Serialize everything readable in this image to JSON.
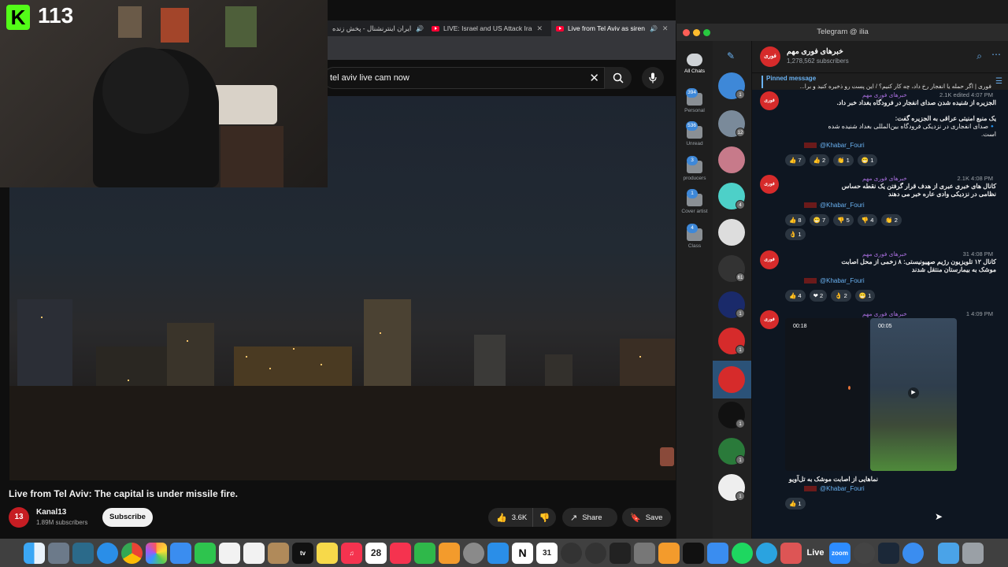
{
  "webcam": {
    "logo_letter": "K",
    "viewer_count": "113"
  },
  "browser": {
    "tabs": [
      {
        "label": "ایران اینترنشنال - پخش زنده",
        "active": false
      },
      {
        "label": "LIVE: Israel and US Attack Ira",
        "active": false
      },
      {
        "label": "Live from Tel Aviv as siren",
        "active": true
      }
    ],
    "search": {
      "query": "tel aviv live cam now"
    }
  },
  "youtube": {
    "video_title": "Live from Tel Aviv: The capital is under missile fire.",
    "channel_avatar_text": "13",
    "channel_name": "Kanal13",
    "channel_subscribers": "1.89M subscribers",
    "subscribe_label": "Subscribe",
    "like_count": "3.6K",
    "share_label": "Share",
    "save_label": "Save"
  },
  "telegram": {
    "window_title": "Telegram @ ilia",
    "folders": [
      {
        "label": "All Chats",
        "badge": ""
      },
      {
        "label": "Personal",
        "badge": "394"
      },
      {
        "label": "Unread",
        "badge": "536"
      },
      {
        "label": "producers",
        "badge": "3"
      },
      {
        "label": "Cover artist",
        "badge": "1"
      },
      {
        "label": "Class",
        "badge": "4"
      }
    ],
    "chat_badges": [
      "1",
      "12",
      "",
      "4",
      "",
      "61",
      "1",
      "1",
      "",
      "1",
      "1",
      "1"
    ],
    "channel": {
      "name": "خبرهای فوری مهم",
      "subscribers": "1,278,562 subscribers",
      "avatar_text": "فوری"
    },
    "pinned": {
      "label": "Pinned message",
      "text": "فوری | اگر حمله یا انفجار رخ داد، چه کار کنیم؟ / این پست رو ذخیره کنید و برا..."
    },
    "messages": [
      {
        "author": "خبرهای فوری مهم",
        "meta": "2.1K edited 4:07 PM",
        "lines": [
          "الجزیره از شنیده شدن صدای انفجار در فرودگاه بغداد خبر داد.",
          "",
          "یک منبع امنیتی عراقی به الجزیره گفت:",
          "🔹صدای انفجاری در نزدیکی فرودگاه بین‌المللی بغداد شنیده شده",
          "است."
        ],
        "link": "@Khabar_Fouri",
        "reactions": [
          "👍 7",
          "👍 2",
          "👏 1",
          "😁 1"
        ]
      },
      {
        "author": "خبرهای فوری مهم",
        "meta": "2.1K 4:08 PM",
        "lines": [
          "کانال های خبری عبری از هدف قرار گرفتن یک نقطه حساس",
          "نظامی در نزدیکی وادی عاره خبر می دهند"
        ],
        "link": "@Khabar_Fouri",
        "reactions": [
          "👍 8",
          "😁 7",
          "👎 5",
          "👎 4",
          "👏 2",
          "👌 1"
        ]
      },
      {
        "author": "خبرهای فوری مهم",
        "meta": "31 4:08 PM",
        "lines": [
          "کانال ۱۲ تلویزیون رژیم صهیونیستی: ۸ زخمی از محل اصابت",
          "موشک به بیمارستان منتقل شدند"
        ],
        "link": "@Khabar_Fouri",
        "reactions": [
          "👍 4",
          "❤ 2",
          "👌 2",
          "😁 1"
        ]
      },
      {
        "author": "خبرهای فوری مهم",
        "meta": "1 4:09 PM",
        "video_durations": [
          "00:18",
          "00:05"
        ],
        "lines": [
          "نماهایی از اصابت موشک به تل‌آویو"
        ],
        "link": "@Khabar_Fouri",
        "reactions": [
          "👍 1"
        ]
      }
    ]
  },
  "dock": {
    "calendar_day": "28",
    "live_label": "Live",
    "zoom_label": "zoom"
  },
  "icons": {
    "search": "search-icon",
    "mic": "microphone-icon",
    "close": "close-icon",
    "like": "thumbs-up-icon",
    "dislike": "thumbs-down-icon",
    "share": "share-icon",
    "save": "bookmark-icon"
  }
}
